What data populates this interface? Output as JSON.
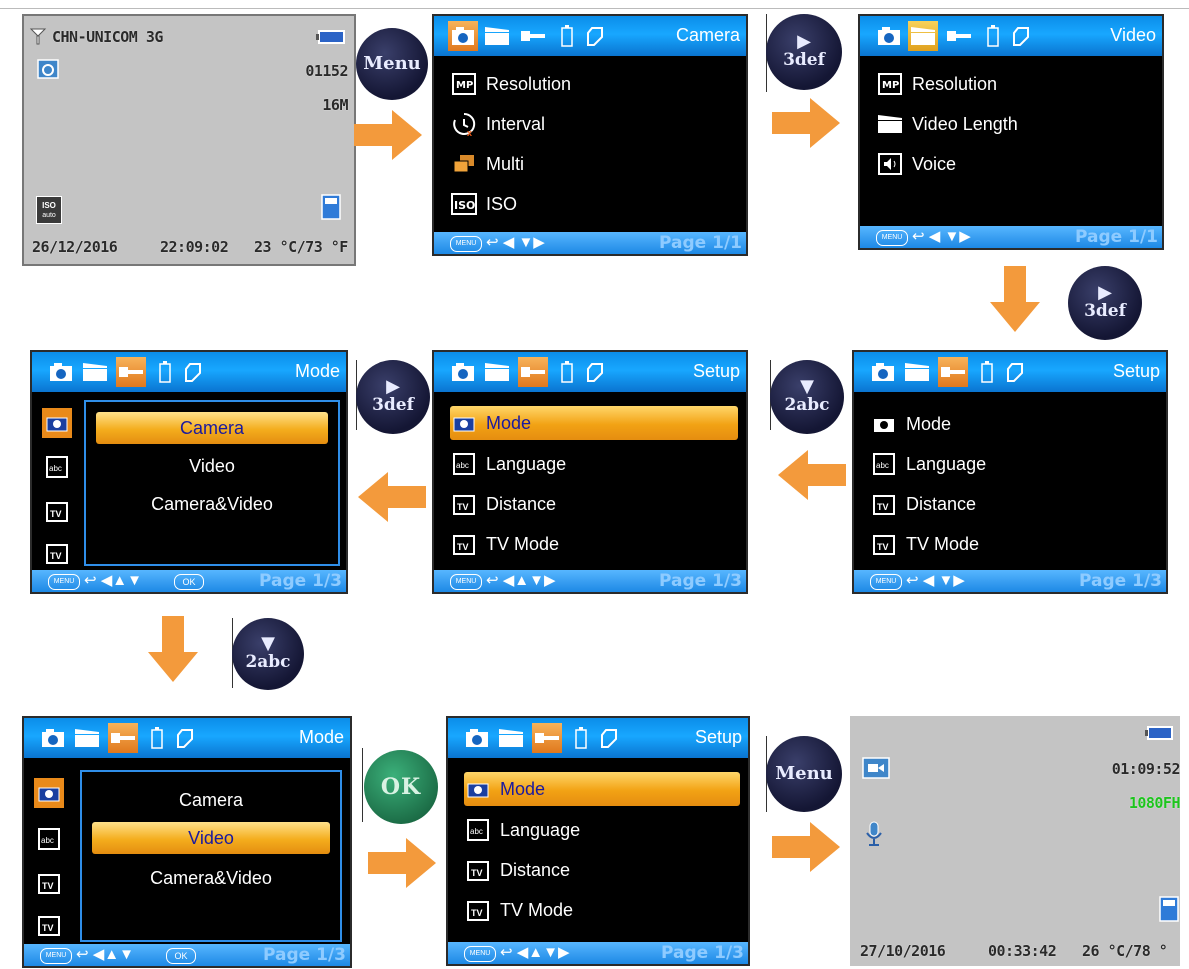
{
  "standby1": {
    "carrier": "CHN-UNICOM 3G",
    "shots": "01152",
    "resolution": "16M",
    "iso_badge": "ISO",
    "iso_sub": "auto",
    "date": "26/12/2016",
    "time": "22:09:02",
    "temp": "23 °C/73 °F"
  },
  "screen_camera": {
    "title": "Camera",
    "items": [
      "Resolution",
      "Interval",
      "Multi",
      "ISO"
    ],
    "page": "Page 1/1",
    "menu_pill": "MENU"
  },
  "screen_video": {
    "title": "Video",
    "items": [
      "Resolution",
      "Video Length",
      "Voice"
    ],
    "page": "Page 1/1",
    "menu_pill": "MENU"
  },
  "screen_setup_a": {
    "title": "Setup",
    "items": [
      "Mode",
      "Language",
      "Distance",
      "TV Mode"
    ],
    "page": "Page 1/3",
    "menu_pill": "MENU"
  },
  "screen_setup_b": {
    "title": "Setup",
    "items": [
      "Mode",
      "Language",
      "Distance",
      "TV Mode"
    ],
    "page": "Page 1/3",
    "menu_pill": "MENU"
  },
  "screen_mode_a": {
    "title": "Mode",
    "options": [
      "Camera",
      "Video",
      "Camera&Video"
    ],
    "page": "Page 1/3",
    "menu_pill": "MENU",
    "ok_pill": "OK"
  },
  "screen_mode_b": {
    "title": "Mode",
    "options": [
      "Camera",
      "Video",
      "Camera&Video"
    ],
    "page": "Page 1/3",
    "menu_pill": "MENU",
    "ok_pill": "OK"
  },
  "screen_setup_c": {
    "title": "Setup",
    "items": [
      "Mode",
      "Language",
      "Distance",
      "TV Mode"
    ],
    "page": "Page 1/3",
    "menu_pill": "MENU"
  },
  "standby2": {
    "record_time": "01:09:52",
    "video_res": "1080FH",
    "date": "27/10/2016",
    "time": "00:33:42",
    "temp": "26 °C/78 °"
  },
  "buttons": {
    "menu": "Menu",
    "play_3def": "3def",
    "down_2abc": "2abc",
    "ok": "OK"
  },
  "colors": {
    "accent_blue": "#18a7ff",
    "highlight_orange": "#f2a214",
    "arrow_orange": "#f39a3c",
    "lcd_grey": "#c4c4c4",
    "video_green": "#1ec41e"
  }
}
